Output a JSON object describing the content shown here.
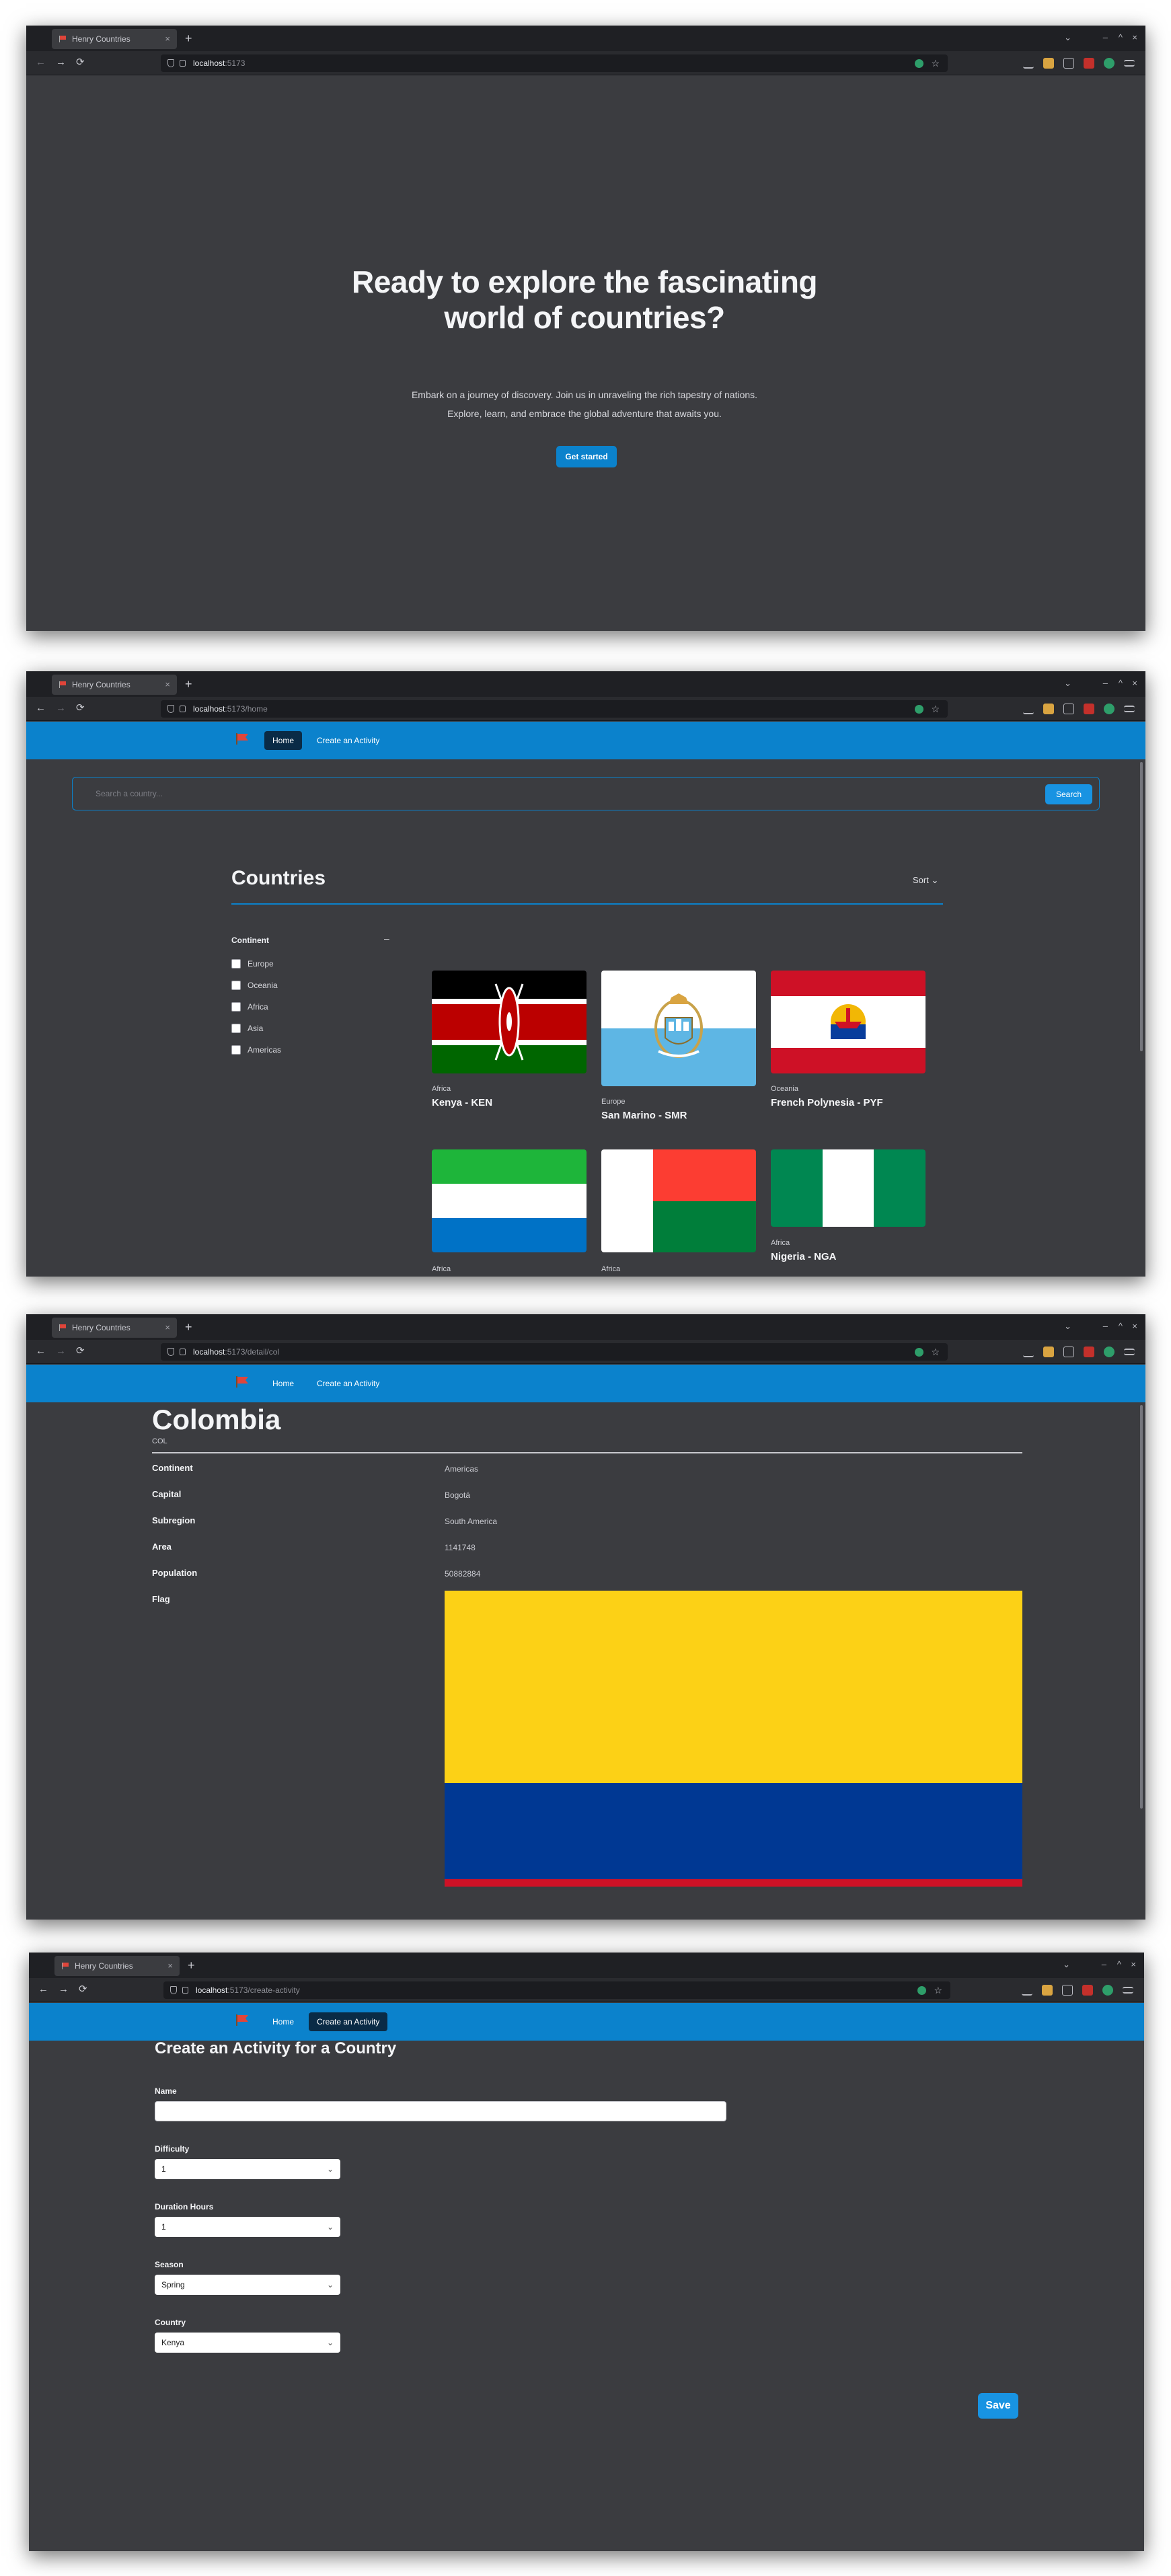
{
  "browser": {
    "tab_title": "Henry Countries",
    "tab_close": "×",
    "new_tab": "+",
    "nav_back": "←",
    "nav_forward": "→",
    "nav_reload": "⟳",
    "star": "☆",
    "win_chevron": "⌄",
    "win_min": "–",
    "win_max": "^",
    "win_close": "×"
  },
  "app_nav": {
    "home": "Home",
    "create_activity": "Create an Activity"
  },
  "landing": {
    "url_host": "localhost",
    "url_path": ":5173",
    "title": "Ready to explore the fascinating world of countries?",
    "subtitle": "Embark on a journey of discovery. Join us in unraveling the rich tapestry of nations. Explore, learn, and embrace the global adventure that awaits you.",
    "cta": "Get started"
  },
  "home": {
    "url_host": "localhost",
    "url_path": ":5173/home",
    "search_placeholder": "Search a country...",
    "search_button": "Search",
    "section_title": "Countries",
    "sort_label": "Sort",
    "filter_title": "Continent",
    "filter_toggle": "–",
    "continents": [
      "Europe",
      "Oceania",
      "Africa",
      "Asia",
      "Americas"
    ],
    "countries": [
      {
        "continent": "Africa",
        "name": "Kenya - KEN"
      },
      {
        "continent": "Europe",
        "name": "San Marino - SMR"
      },
      {
        "continent": "Oceania",
        "name": "French Polynesia - PYF"
      },
      {
        "continent": "Africa",
        "name": ""
      },
      {
        "continent": "Africa",
        "name": ""
      },
      {
        "continent": "Africa",
        "name": "Nigeria - NGA"
      }
    ]
  },
  "detail": {
    "url_host": "localhost",
    "url_path": ":5173/detail/col",
    "country": "Colombia",
    "code": "COL",
    "fields": [
      {
        "label": "Continent",
        "value": "Americas"
      },
      {
        "label": "Capital",
        "value": "Bogotá"
      },
      {
        "label": "Subregion",
        "value": "South America"
      },
      {
        "label": "Area",
        "value": "1141748"
      },
      {
        "label": "Population",
        "value": "50882884"
      },
      {
        "label": "Flag",
        "value": ""
      }
    ],
    "flag_colors": [
      "#fcd116",
      "#003893",
      "#ce1126"
    ]
  },
  "create": {
    "url_host": "localhost",
    "url_path": ":5173/create-activity",
    "title": "Create an Activity for a Country",
    "name_label": "Name",
    "name_value": "",
    "difficulty_label": "Difficulty",
    "difficulty_value": "1",
    "duration_label": "Duration Hours",
    "duration_value": "1",
    "season_label": "Season",
    "season_value": "Spring",
    "country_label": "Country",
    "country_value": "Kenya",
    "save_button": "Save"
  },
  "colors": {
    "app_blue": "#0b82cc",
    "page_bg": "#3b3c40",
    "nav_active": "#0a2b46"
  }
}
